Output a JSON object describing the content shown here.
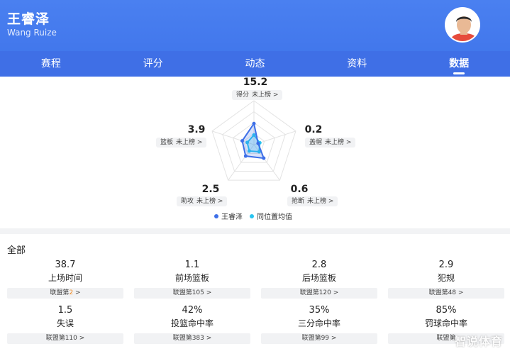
{
  "player": {
    "name_cn": "王睿泽",
    "name_en": "Wang Ruize"
  },
  "tabs": [
    {
      "label": "赛程",
      "active": false
    },
    {
      "label": "评分",
      "active": false
    },
    {
      "label": "动态",
      "active": false
    },
    {
      "label": "资料",
      "active": false
    },
    {
      "label": "数据",
      "active": true
    }
  ],
  "radar": {
    "stats": [
      {
        "value": "15.2",
        "label": "得分",
        "rank": "未上榜 >"
      },
      {
        "value": "0.2",
        "label": "盖帽",
        "rank": "未上榜 >"
      },
      {
        "value": "0.6",
        "label": "抢断",
        "rank": "未上榜 >"
      },
      {
        "value": "2.5",
        "label": "助攻",
        "rank": "未上榜 >"
      },
      {
        "value": "3.9",
        "label": "篮板",
        "rank": "未上榜 >"
      }
    ],
    "player_pct": [
      0.48,
      0.1,
      0.38,
      0.32,
      0.28
    ],
    "avg_pct": [
      0.22,
      0.14,
      0.2,
      0.18,
      0.16
    ],
    "legend": {
      "player": "王睿泽",
      "avg": "同位置均值"
    },
    "colors": {
      "player": "#3d6fe8",
      "avg": "#29c4f0"
    }
  },
  "all": {
    "title": "全部",
    "cells": [
      {
        "value": "38.7",
        "name": "上场时间",
        "rank_prefix": "联盟第",
        "rank_num": "2",
        "rank_suffix": " >",
        "highlight": true
      },
      {
        "value": "1.1",
        "name": "前场篮板",
        "rank_prefix": "联盟第",
        "rank_num": "105",
        "rank_suffix": " >",
        "highlight": false
      },
      {
        "value": "2.8",
        "name": "后场篮板",
        "rank_prefix": "联盟第",
        "rank_num": "120",
        "rank_suffix": " >",
        "highlight": false
      },
      {
        "value": "2.9",
        "name": "犯规",
        "rank_prefix": "联盟第",
        "rank_num": "48",
        "rank_suffix": " >",
        "highlight": false
      },
      {
        "value": "1.5",
        "name": "失误",
        "rank_prefix": "联盟第",
        "rank_num": "110",
        "rank_suffix": " >",
        "highlight": false
      },
      {
        "value": "42%",
        "name": "投篮命中率",
        "rank_prefix": "联盟第",
        "rank_num": "383",
        "rank_suffix": " >",
        "highlight": false
      },
      {
        "value": "35%",
        "name": "三分命中率",
        "rank_prefix": "联盟第",
        "rank_num": "99",
        "rank_suffix": " >",
        "highlight": false
      },
      {
        "value": "85%",
        "name": "罚球命中率",
        "rank_prefix": "联盟第",
        "rank_num": "",
        "rank_suffix": "",
        "highlight": false
      }
    ]
  },
  "watermark": "智说体育",
  "colors": {
    "header": "#4a80f0",
    "highlight": "#f08a24"
  }
}
